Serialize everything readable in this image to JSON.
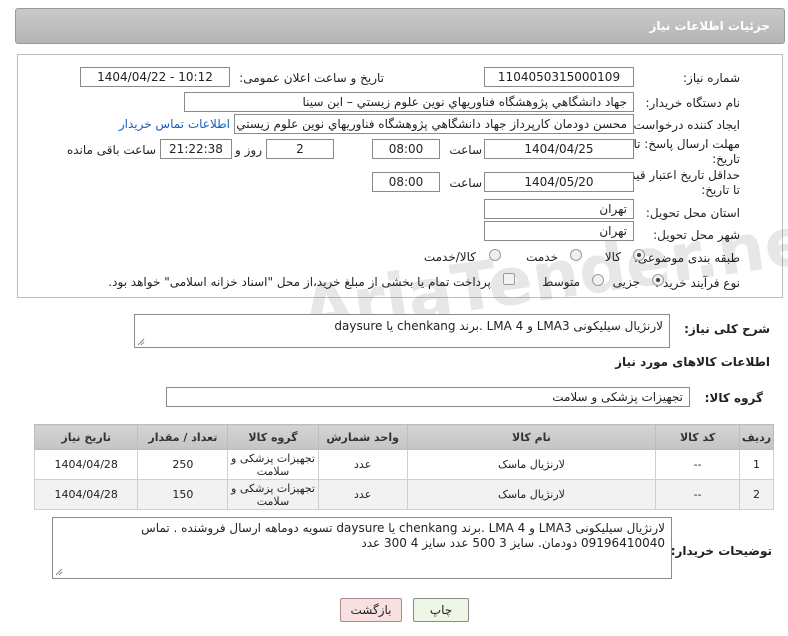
{
  "header": {
    "title": "جزئیات اطلاعات نیاز"
  },
  "form": {
    "need_number": {
      "label": "شماره نیاز:",
      "value": "1104050315000109"
    },
    "announce": {
      "label": "تاریخ و ساعت اعلان عمومی:",
      "value": "1404/04/22 - 10:12"
    },
    "buyer_org": {
      "label": "نام دستگاه خریدار:",
      "value": "جهاد دانشگاهي پژوهشگاه فناوريهاي نوين علوم زيستي – ابن سينا"
    },
    "requester": {
      "label": "ایجاد کننده درخواست:",
      "value": "محسن دودمان کارپرداز جهاد دانشگاهي پژوهشگاه فناوريهاي نوين علوم زيستي",
      "contact_link": "اطلاعات تماس خریدار"
    },
    "reply_deadline": {
      "label_line1": "مهلت ارسال پاسخ: تا",
      "label_line2": "تاریخ:",
      "date": "1404/04/25",
      "time_label": "ساعت",
      "time": "08:00",
      "days": "2",
      "days_label": "روز و",
      "remaining": "21:22:38",
      "remaining_label": "ساعت باقی مانده"
    },
    "price_validity": {
      "label_line1": "حداقل تاریخ اعتبار قیمت:",
      "label_line2": "تا تاریخ:",
      "date": "1404/05/20",
      "time_label": "ساعت",
      "time": "08:00"
    },
    "province": {
      "label": "استان محل تحویل:",
      "value": "تهران"
    },
    "city": {
      "label": "شهر محل تحویل:",
      "value": "تهران"
    },
    "category": {
      "label": "طبقه بندی موضوعی:",
      "options": [
        "کالا",
        "خدمت",
        "کالا/خدمت"
      ],
      "selected": "کالا"
    },
    "process": {
      "label": "نوع فرآیند خرید :",
      "options": [
        "جزیی",
        "متوسط"
      ],
      "selected": "جزیی",
      "note": "پرداخت تمام یا بخشی از مبلغ خرید،از محل \"اسناد خزانه اسلامی\" خواهد بود."
    }
  },
  "description": {
    "label": "شرح کلی نیاز:",
    "value": "لارنژیال سیلیکونی LMA3 و LMA 4 .برند chenkang یا  daysure"
  },
  "goods_info": {
    "title": "اطلاعات کالاهای مورد نیاز",
    "group_label": "گروه کالا:",
    "group_value": "تجهیزات پزشکی و سلامت"
  },
  "table": {
    "headers": [
      "ردیف",
      "کد کالا",
      "نام کالا",
      "واحد شمارش",
      "گروه کالا",
      "تعداد / مقدار",
      "تاریخ نیاز"
    ],
    "rows": [
      [
        "1",
        "--",
        "لارنژیال ماسک",
        "عدد",
        "تجهیزات پزشکی و سلامت",
        "250",
        "1404/04/28"
      ],
      [
        "2",
        "--",
        "لارنژیال ماسک",
        "عدد",
        "تجهیزات پزشکی و سلامت",
        "150",
        "1404/04/28"
      ]
    ]
  },
  "buyer_notes": {
    "label": "توضیحات خریدار:",
    "value": "لارنژیال سیلیکونی LMA3 و LMA 4 .برند chenkang یا daysure تسویه دوماهه ارسال فروشنده . تماس 09196410040 دودمان. سایز 3 500 عدد سایز 4 300 عدد"
  },
  "buttons": {
    "print": "چاپ",
    "back": "بازگشت"
  },
  "watermark": "AriaTender.net"
}
